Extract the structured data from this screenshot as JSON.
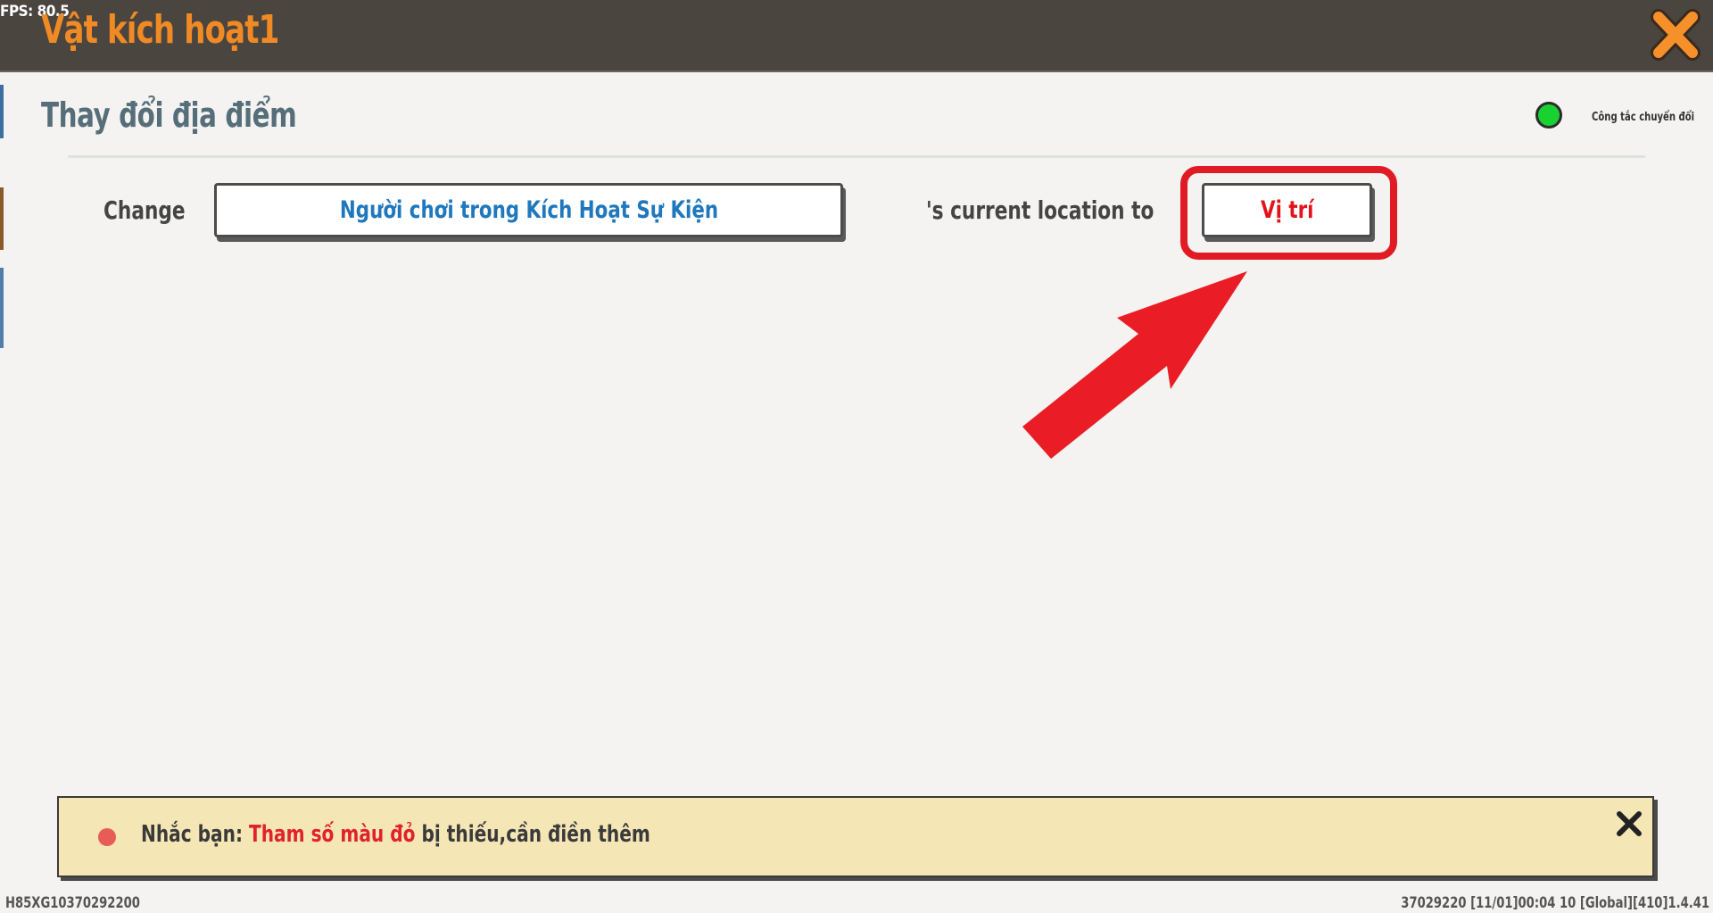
{
  "header": {
    "fps": "FPS: 80.5",
    "title": "Vật kích hoạt1",
    "close_icon": "close-x-icon"
  },
  "panel": {
    "section_title": "Thay đổi địa điểm",
    "toggle": {
      "label": "Công tắc chuyển đổi",
      "state": "on",
      "color": "#19d130"
    },
    "action_row": {
      "prefix": "Change",
      "target_param": {
        "label": "Người chơi trong Kích Hoạt Sự Kiện",
        "color": "#1f78bd"
      },
      "middle_text": "'s current location to",
      "location_param": {
        "label": "Vị trí",
        "color": "#e1141b",
        "missing": true
      }
    },
    "annotation": {
      "highlight": "red-rounded-box",
      "arrow": "red-arrow-icon",
      "color": "#e01b24"
    }
  },
  "notice": {
    "prefix": "Nhắc bạn:",
    "highlight": "Tham số màu đỏ",
    "suffix": "bị thiếu,cần điền thêm"
  },
  "footer": {
    "left": "H85XG10370292200",
    "right": "37029220   [11/01]00:04 10  [Global][410]1.4.41"
  }
}
